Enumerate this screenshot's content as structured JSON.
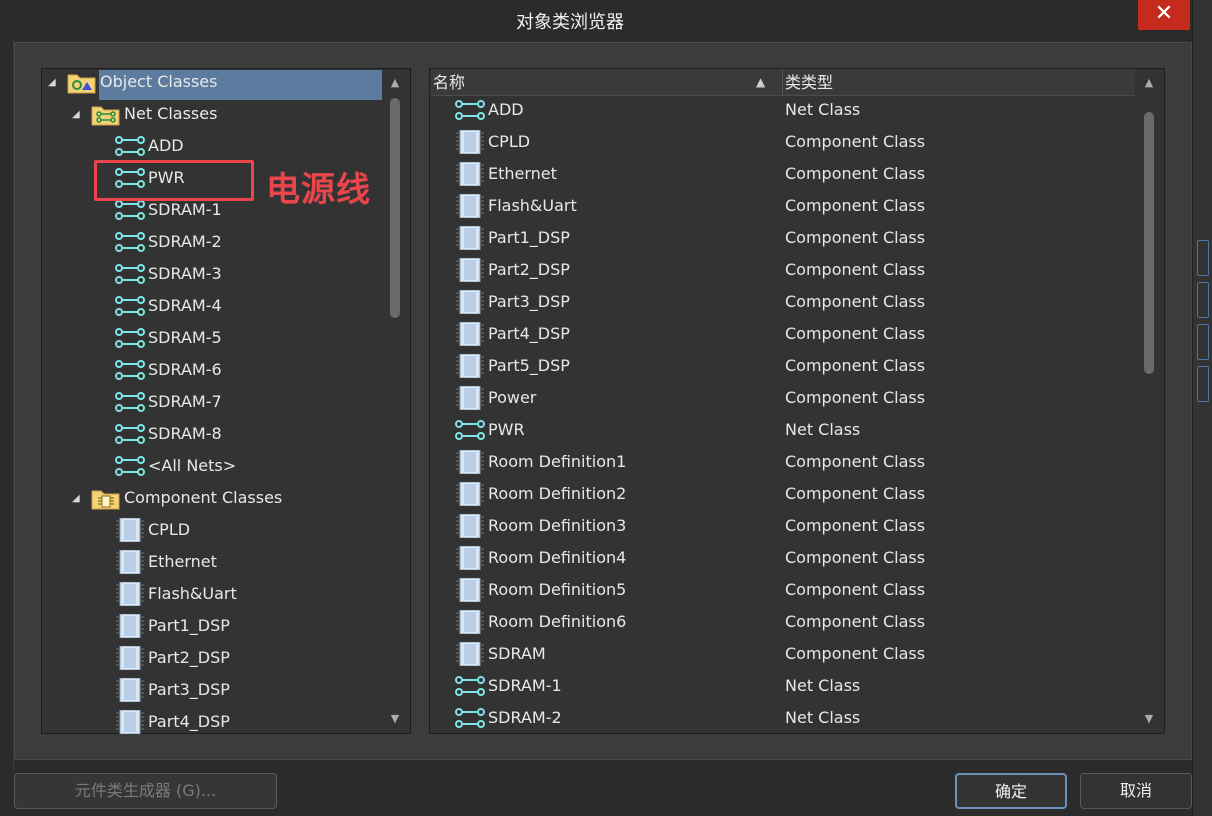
{
  "window": {
    "title": "对象类浏览器",
    "close_label": "✕"
  },
  "tree": {
    "root": {
      "label": "Object Classes",
      "icon": "object-classes-folder-icon"
    },
    "net_classes": {
      "label": "Net Classes",
      "items": [
        "ADD",
        "PWR",
        "SDRAM-1",
        "SDRAM-2",
        "SDRAM-3",
        "SDRAM-4",
        "SDRAM-5",
        "SDRAM-6",
        "SDRAM-7",
        "SDRAM-8",
        "<All Nets>"
      ]
    },
    "component_classes": {
      "label": "Component Classes",
      "items": [
        "CPLD",
        "Ethernet",
        "Flash&Uart",
        "Part1_DSP",
        "Part2_DSP",
        "Part3_DSP",
        "Part4_DSP"
      ]
    }
  },
  "annotation": {
    "text": "电源线"
  },
  "list": {
    "columns": [
      "名称",
      "类类型"
    ],
    "rows": [
      {
        "name": "ADD",
        "type": "Net Class",
        "icon": "net"
      },
      {
        "name": "CPLD",
        "type": "Component Class",
        "icon": "component"
      },
      {
        "name": "Ethernet",
        "type": "Component Class",
        "icon": "component"
      },
      {
        "name": "Flash&Uart",
        "type": "Component Class",
        "icon": "component"
      },
      {
        "name": "Part1_DSP",
        "type": "Component Class",
        "icon": "component"
      },
      {
        "name": "Part2_DSP",
        "type": "Component Class",
        "icon": "component"
      },
      {
        "name": "Part3_DSP",
        "type": "Component Class",
        "icon": "component"
      },
      {
        "name": "Part4_DSP",
        "type": "Component Class",
        "icon": "component"
      },
      {
        "name": "Part5_DSP",
        "type": "Component Class",
        "icon": "component"
      },
      {
        "name": "Power",
        "type": "Component Class",
        "icon": "component"
      },
      {
        "name": "PWR",
        "type": "Net Class",
        "icon": "net"
      },
      {
        "name": "Room Definition1",
        "type": "Component Class",
        "icon": "component"
      },
      {
        "name": "Room Definition2",
        "type": "Component Class",
        "icon": "component"
      },
      {
        "name": "Room Definition3",
        "type": "Component Class",
        "icon": "component"
      },
      {
        "name": "Room Definition4",
        "type": "Component Class",
        "icon": "component"
      },
      {
        "name": "Room Definition5",
        "type": "Component Class",
        "icon": "component"
      },
      {
        "name": "Room Definition6",
        "type": "Component Class",
        "icon": "component"
      },
      {
        "name": "SDRAM",
        "type": "Component Class",
        "icon": "component"
      },
      {
        "name": "SDRAM-1",
        "type": "Net Class",
        "icon": "net"
      },
      {
        "name": "SDRAM-2",
        "type": "Net Class",
        "icon": "net"
      }
    ]
  },
  "buttons": {
    "generator": "元件类生成器 (G)...",
    "ok": "确定",
    "cancel": "取消"
  },
  "colors": {
    "selection": "#5b7c9e",
    "annotation": "#e8464a",
    "net_icon": "#7ee3e8",
    "close": "#c42b1c"
  }
}
